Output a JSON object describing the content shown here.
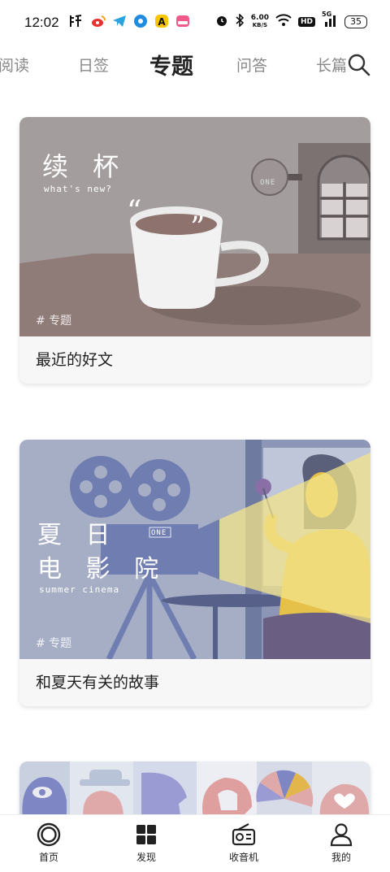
{
  "status_bar": {
    "time": "12:02",
    "net_speed_value": "6.00",
    "net_speed_unit": "KB/S",
    "hd_label": "HD",
    "signal_label": "5G",
    "battery": "35"
  },
  "tabs": [
    {
      "label": "阅读"
    },
    {
      "label": "日签"
    },
    {
      "label": "专题"
    },
    {
      "label": "问答"
    },
    {
      "label": "长篇"
    }
  ],
  "active_tab": "专题",
  "cards": [
    {
      "title": "续 杯",
      "subtitle": "what's new?",
      "tag": "# 专题",
      "sign_text": "ONE",
      "caption": "最近的好文",
      "colors": {
        "bg": "#a39d9e",
        "table": "#8f7b78",
        "wall": "#7c7272"
      }
    },
    {
      "title_line1": "夏 日",
      "title_line2": "电 影 院",
      "subtitle": "summer cinema",
      "tag": "# 专题",
      "sign_text": "ONE",
      "caption": "和夏天有关的故事",
      "colors": {
        "bg": "#a6aec6",
        "projector": "#6f7db0",
        "light": "#e7cf4f"
      }
    },
    {
      "caption": ""
    }
  ],
  "bottom_nav": [
    {
      "label": "首页",
      "icon": "home-icon"
    },
    {
      "label": "发现",
      "icon": "grid-icon"
    },
    {
      "label": "收音机",
      "icon": "radio-icon"
    },
    {
      "label": "我的",
      "icon": "person-icon"
    }
  ]
}
